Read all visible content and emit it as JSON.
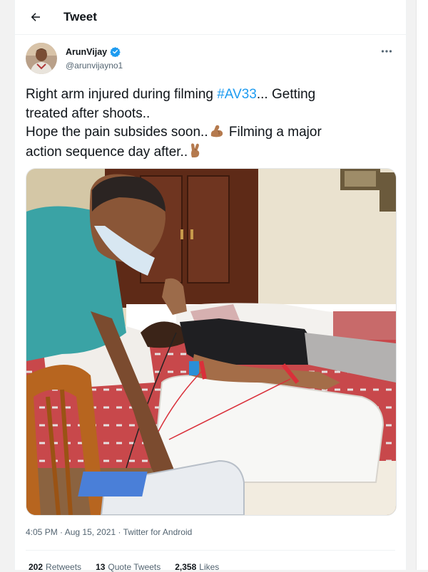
{
  "header": {
    "title": "Tweet"
  },
  "author": {
    "display_name": "ArunVijay",
    "handle": "@arunvijayno1",
    "verified": true
  },
  "tweet": {
    "line1_pre": "Right arm injured during filming ",
    "hashtag": "#AV33",
    "line1_post": "... Getting",
    "line2": "treated after shoots..",
    "line3_pre": "Hope the pain subsides soon..",
    "line3_post": " Filming a major",
    "line4": "action sequence day after.."
  },
  "meta": {
    "time": "4:05 PM",
    "sep1": " · ",
    "date": "Aug 15, 2021",
    "sep2": " · ",
    "source": "Twitter for Android"
  },
  "stats": {
    "retweets_count": "202",
    "retweets_label": "Retweets",
    "quotes_count": "13",
    "quotes_label": "Quote Tweets",
    "likes_count": "2,358",
    "likes_label": "Likes"
  },
  "icons": {
    "back": "arrow-left-icon",
    "verified": "verified-badge-icon",
    "more": "more-horizontal-icon",
    "emoji1": "flexed-biceps-emoji",
    "emoji2": "crossed-fingers-emoji"
  },
  "colors": {
    "accent": "#1d9bf0",
    "text": "#0f1419",
    "secondary": "#536471"
  }
}
